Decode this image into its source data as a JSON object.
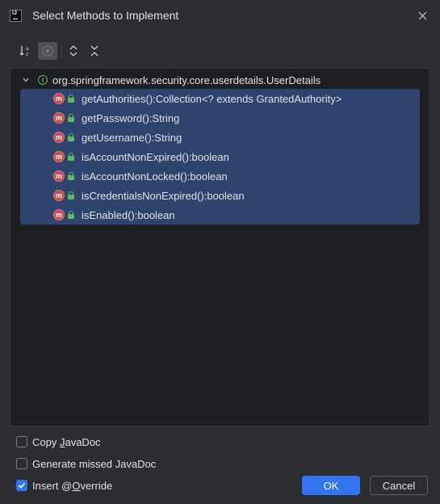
{
  "window": {
    "title": "Select Methods to Implement",
    "app_icon_text": "IJ"
  },
  "toolbar": {
    "buttons": [
      {
        "icon": "sort-alphabetically-icon"
      },
      {
        "icon": "show-inherited-icon",
        "active": true
      },
      {
        "icon": "expand-all-icon"
      },
      {
        "icon": "collapse-all-icon"
      }
    ]
  },
  "tree": {
    "root": {
      "icon": "interface-icon",
      "icon_glyph": "I",
      "label": "org.springframework.security.core.userdetails.UserDetails",
      "expanded": true
    },
    "methods": [
      {
        "label": "getAuthorities():Collection<? extends GrantedAuthority>",
        "selected": true
      },
      {
        "label": "getPassword():String",
        "selected": true
      },
      {
        "label": "getUsername():String",
        "selected": true
      },
      {
        "label": "isAccountNonExpired():boolean",
        "selected": true
      },
      {
        "label": "isAccountNonLocked():boolean",
        "selected": true
      },
      {
        "label": "isCredentialsNonExpired():boolean",
        "selected": true
      },
      {
        "label": "isEnabled():boolean",
        "selected": true
      }
    ],
    "method_icon_glyph": "m"
  },
  "options": {
    "copy_javadoc": {
      "pre": "Copy ",
      "mnemonic": "J",
      "post": "avaDoc",
      "checked": false
    },
    "generate_missed_javadoc": {
      "label": "Generate missed JavaDoc",
      "checked": false
    },
    "insert_override": {
      "pre": "Insert @",
      "mnemonic": "O",
      "post": "verride",
      "checked": true
    }
  },
  "buttons": {
    "ok": "OK",
    "cancel": "Cancel"
  },
  "colors": {
    "accent": "#3574f0",
    "selection": "#2e436e",
    "method_icon": "#c94f4f",
    "access_icon": "#5fb865"
  }
}
